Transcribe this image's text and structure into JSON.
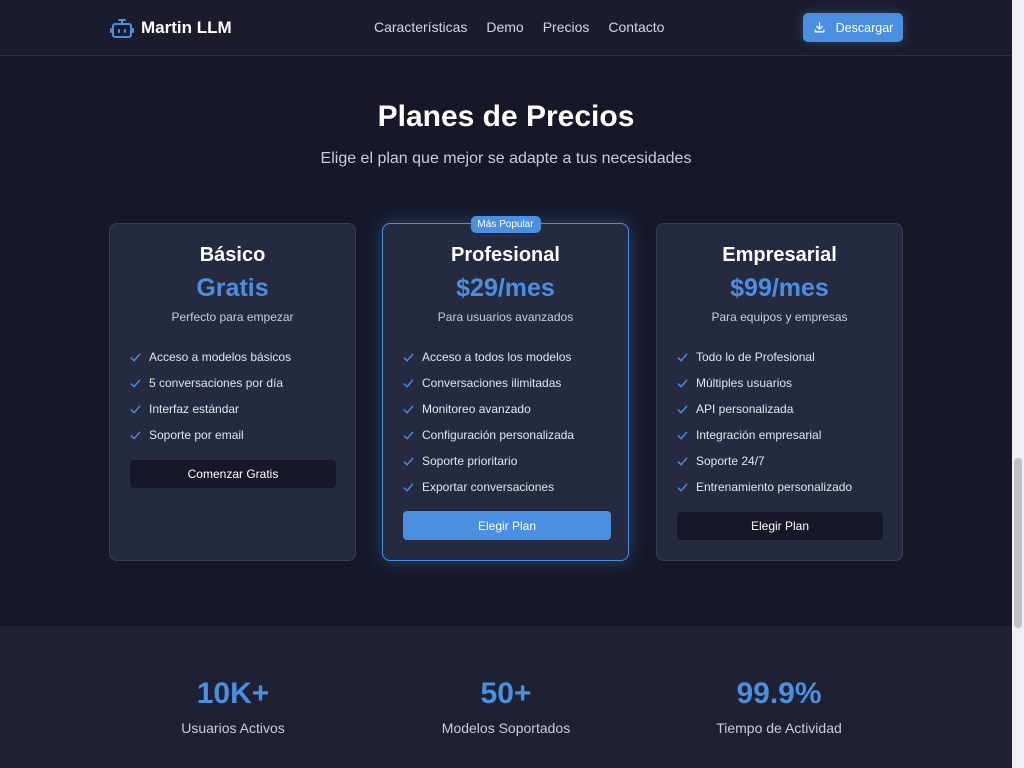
{
  "header": {
    "brand": "Martin LLM",
    "nav": [
      "Características",
      "Demo",
      "Precios",
      "Contacto"
    ],
    "download_label": "Descargar"
  },
  "pricing": {
    "title": "Planes de Precios",
    "subtitle": "Elige el plan que mejor se adapte a tus necesidades",
    "plans": [
      {
        "name": "Básico",
        "price": "Gratis",
        "description": "Perfecto para empezar",
        "features": [
          "Acceso a modelos básicos",
          "5 conversaciones por día",
          "Interfaz estándar",
          "Soporte por email"
        ],
        "cta": "Comenzar Gratis"
      },
      {
        "badge": "Más Popular",
        "name": "Profesional",
        "price": "$29/mes",
        "description": "Para usuarios avanzados",
        "features": [
          "Acceso a todos los modelos",
          "Conversaciones ilimitadas",
          "Monitoreo avanzado",
          "Configuración personalizada",
          "Soporte prioritario",
          "Exportar conversaciones"
        ],
        "cta": "Elegir Plan"
      },
      {
        "name": "Empresarial",
        "price": "$99/mes",
        "description": "Para equipos y empresas",
        "features": [
          "Todo lo de Profesional",
          "Múltiples usuarios",
          "API personalizada",
          "Integración empresarial",
          "Soporte 24/7",
          "Entrenamiento personalizado"
        ],
        "cta": "Elegir Plan"
      }
    ]
  },
  "stats": [
    {
      "value": "10K+",
      "label": "Usuarios Activos"
    },
    {
      "value": "50+",
      "label": "Modelos Soportados"
    },
    {
      "value": "99.9%",
      "label": "Tiempo de Actividad"
    }
  ],
  "colors": {
    "accent": "#4a8fe0",
    "background": "#161829",
    "card": "#262a40"
  }
}
